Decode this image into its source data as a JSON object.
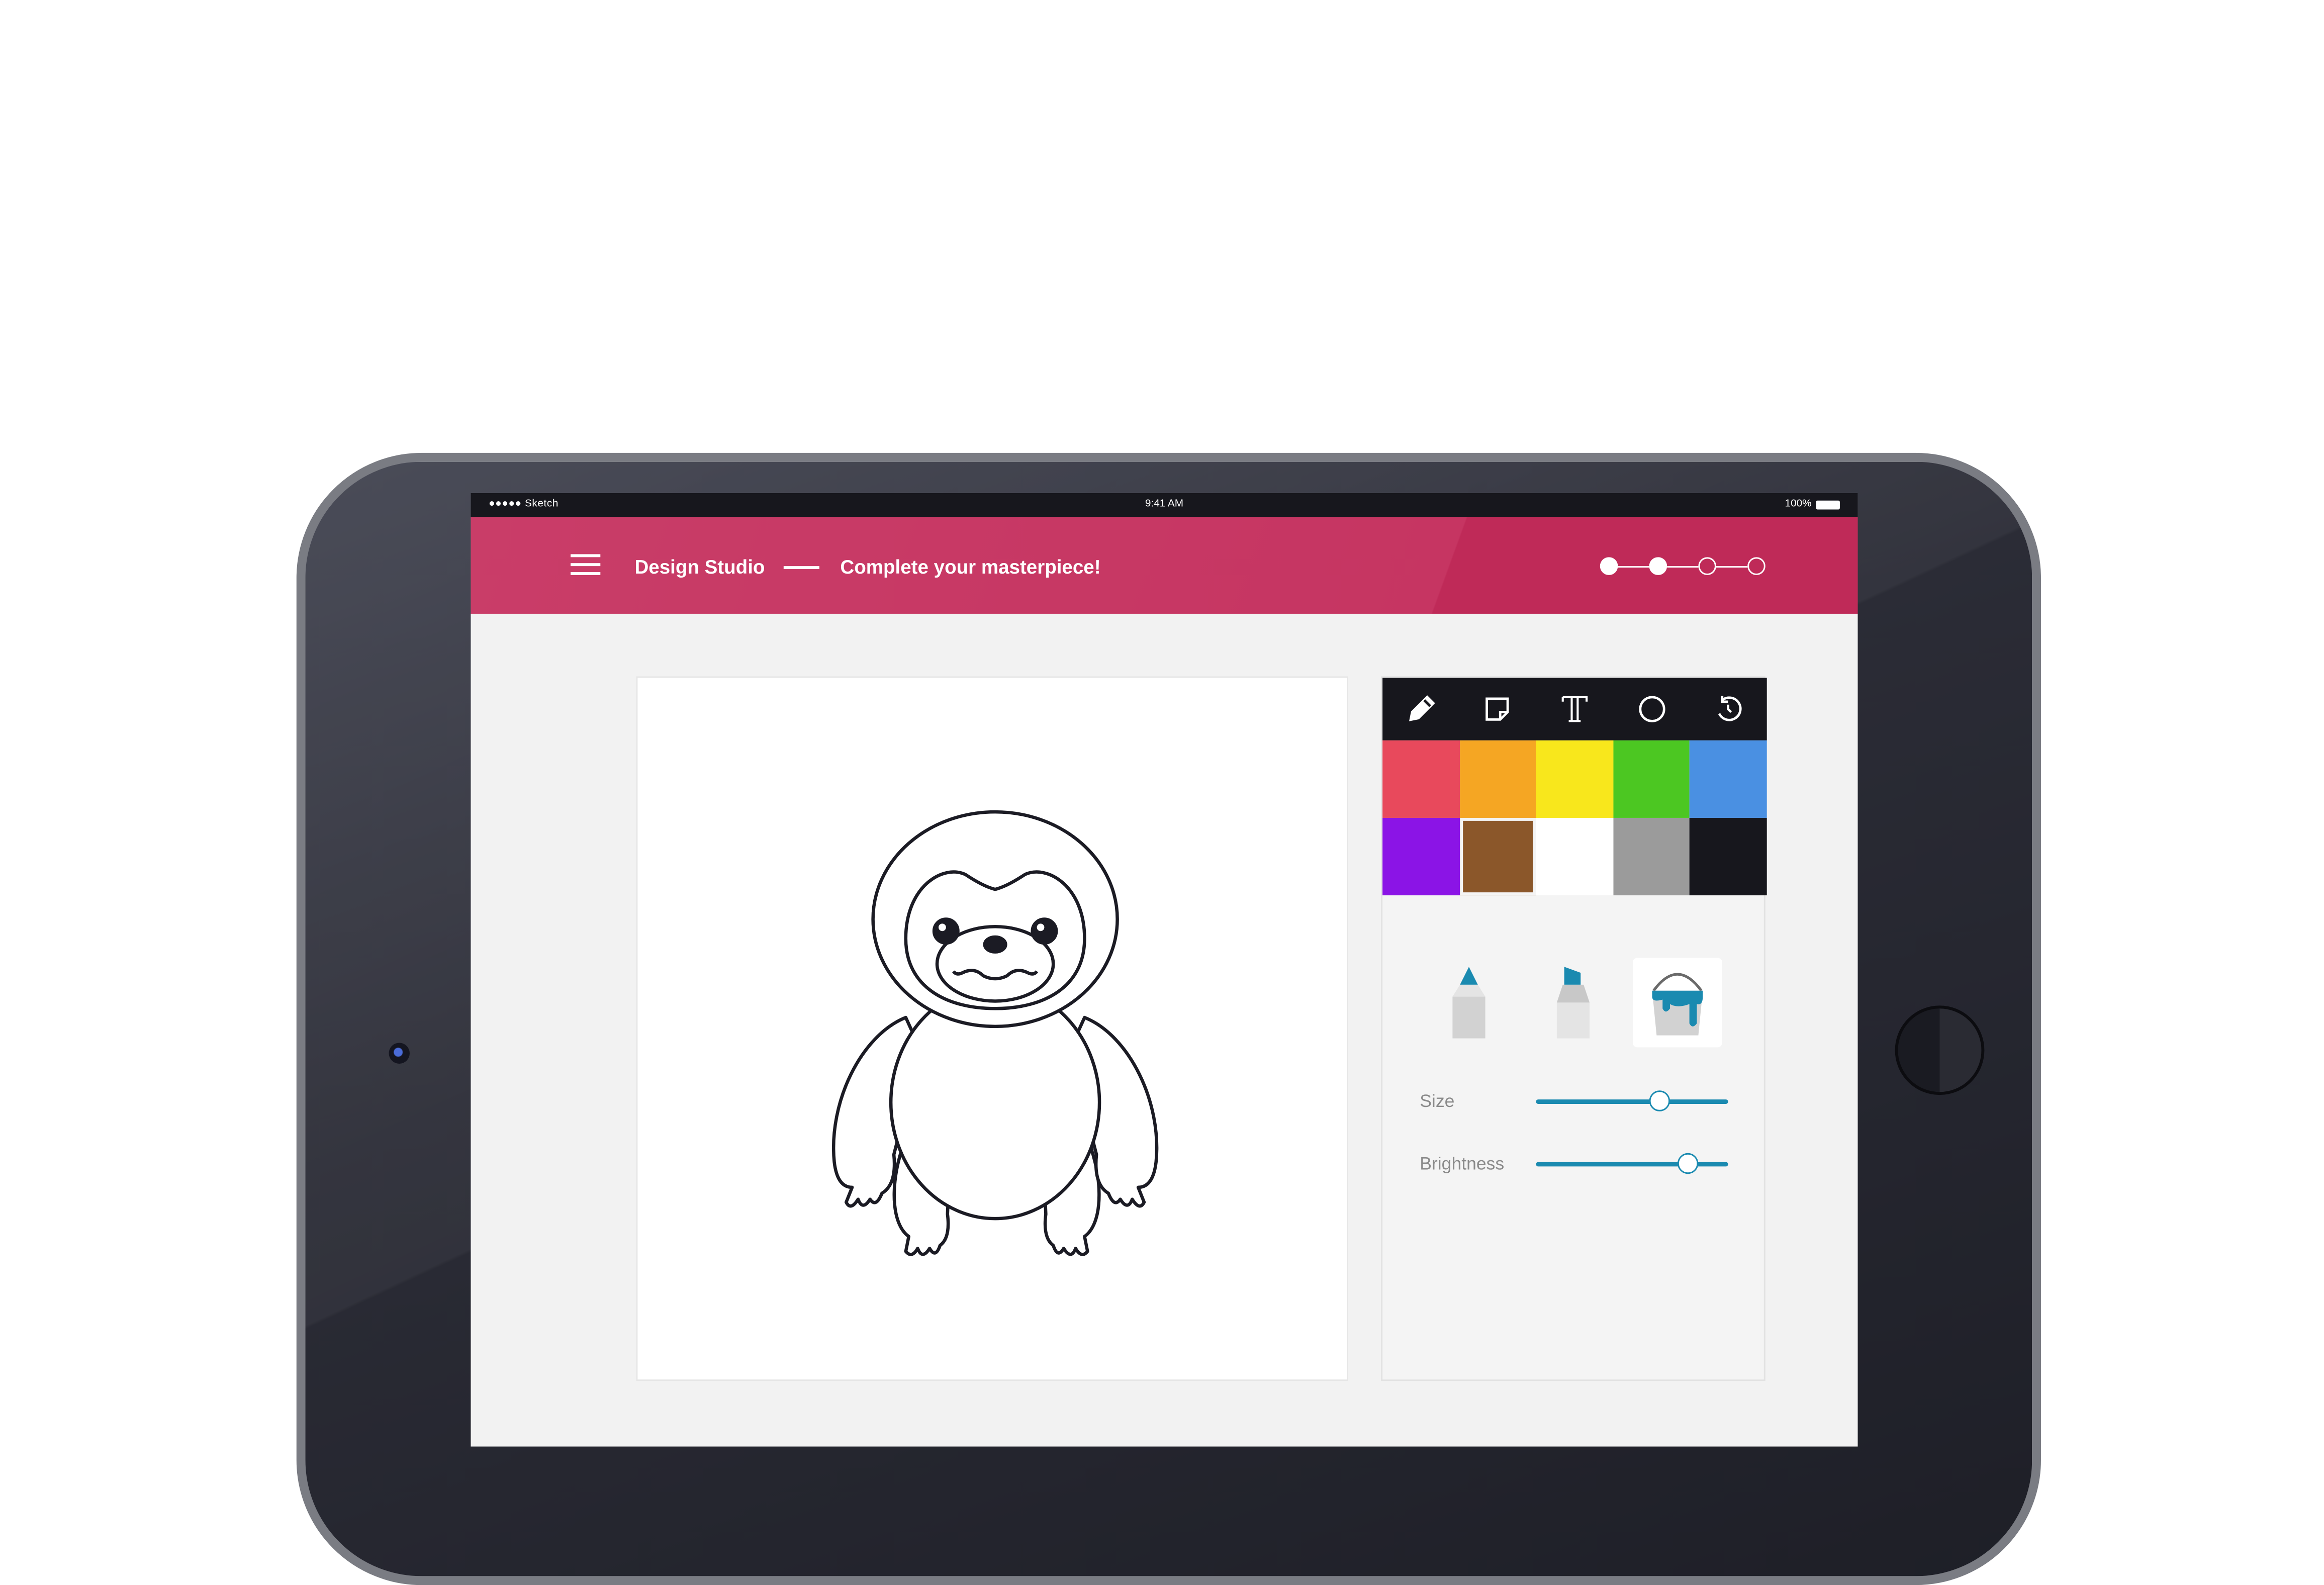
{
  "status_bar": {
    "carrier": "●●●●● Sketch",
    "time": "9:41 AM",
    "battery": "100%"
  },
  "header": {
    "menu_icon": "hamburger-menu-icon",
    "title": "Design Studio",
    "subtitle": "Complete your masterpiece!",
    "steps_total": 4,
    "steps_completed": 2
  },
  "toolbar": {
    "tools": [
      {
        "icon": "pencil-icon",
        "active": true
      },
      {
        "icon": "note-icon"
      },
      {
        "icon": "text-icon"
      },
      {
        "icon": "circle-icon"
      },
      {
        "icon": "undo-icon"
      }
    ]
  },
  "palette": {
    "colors": [
      "#e8495c",
      "#f5a623",
      "#f8e71c",
      "#4cc722",
      "#4a90e2",
      "#8b14e6",
      "#8b572a",
      "#ffffff",
      "#9b9b9b",
      "#17171d"
    ],
    "selected_index": 6
  },
  "brushes": [
    {
      "icon": "pencil-brush-icon"
    },
    {
      "icon": "marker-brush-icon"
    },
    {
      "icon": "paint-bucket-icon",
      "active": true
    }
  ],
  "accent_color": "#1a8ab0",
  "header_color": "#c93d68",
  "sliders": {
    "size": {
      "label": "Size",
      "value": 0.64
    },
    "brightness": {
      "label": "Brightness",
      "value": 0.79
    }
  }
}
